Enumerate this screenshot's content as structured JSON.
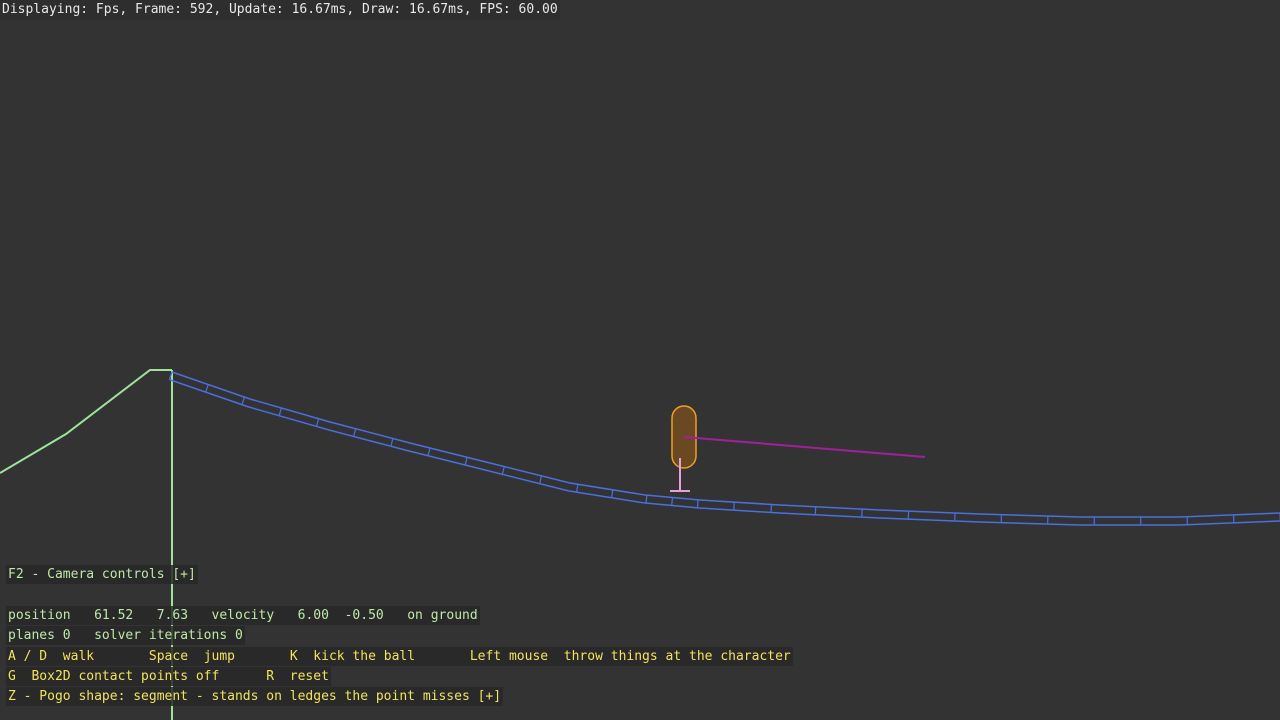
{
  "fps_overlay": {
    "text": "Displaying: Fps, Frame: 592, Update: 16.67ms, Draw: 16.67ms, FPS: 60.00"
  },
  "camera_controls": {
    "label": "F2 - Camera controls [+]"
  },
  "status": {
    "position_label": "position",
    "position_x": "61.52",
    "position_y": "7.63",
    "velocity_label": "velocity",
    "velocity_x": "6.00",
    "velocity_y": "-0.50",
    "ground_state": "on ground",
    "planes_label": "planes 0",
    "solver_label": "solver iterations 0"
  },
  "controls": {
    "walk_key": "A / D",
    "walk_action": "walk",
    "jump_key": "Space",
    "jump_action": "jump",
    "kick_key": "K",
    "kick_action": "kick the ball",
    "throw_key": "Left mouse",
    "throw_action": "throw things at the character",
    "contacts_key": "G",
    "contacts_action": "Box2D contact points off",
    "reset_key": "R",
    "reset_action": "reset",
    "pogo_label": "Z - Pogo shape: segment - stands on ledges the point misses [+]"
  },
  "colors": {
    "background": "#333333",
    "terrain_green": "#9fe39a",
    "track_blue": "#4a6fe0",
    "capsule_orange": "#f0a020",
    "pogo_pink": "#e8a0d8",
    "aim_purple": "#a020a0"
  }
}
